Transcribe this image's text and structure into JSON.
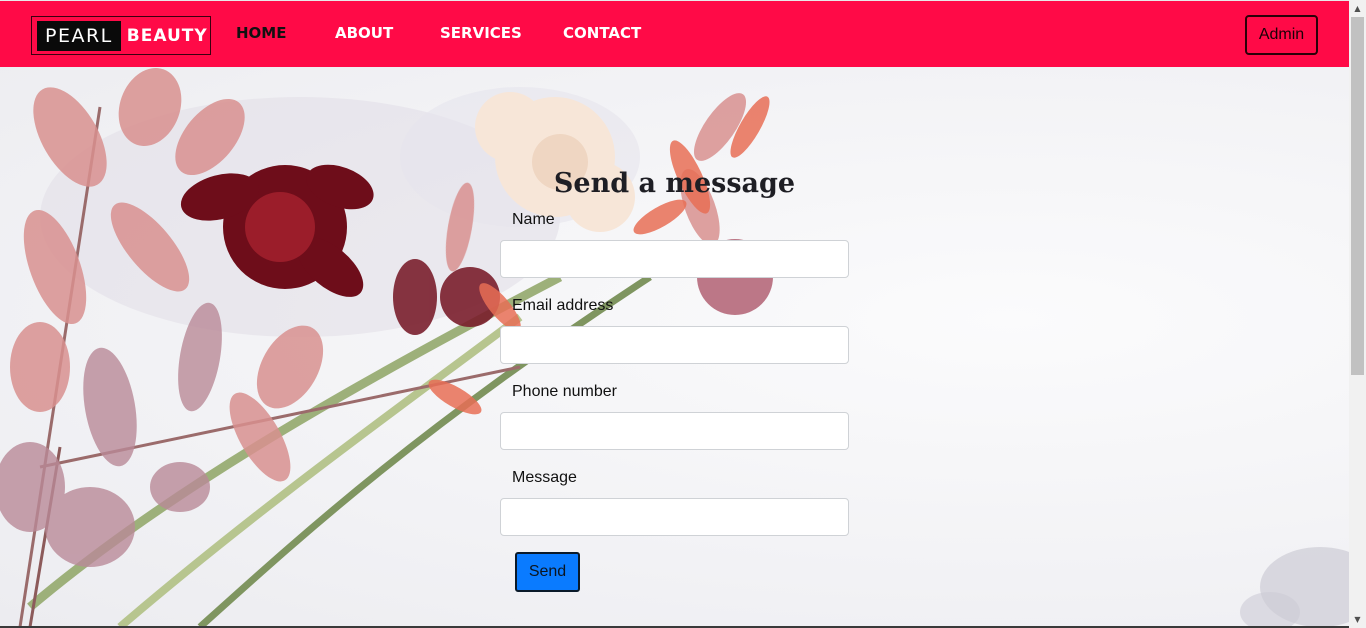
{
  "navbar": {
    "background": "#ff0a47",
    "logo": {
      "pearl": "PEARL",
      "beauty": "BEAUTY"
    },
    "links": [
      {
        "label": "HOME",
        "active": true
      },
      {
        "label": "ABOUT",
        "active": false
      },
      {
        "label": "SERVICES",
        "active": false
      },
      {
        "label": "CONTACT",
        "active": false
      }
    ],
    "admin_label": "Admin"
  },
  "form": {
    "title": "Send a message",
    "fields": [
      {
        "label": "Name",
        "value": ""
      },
      {
        "label": "Email address",
        "value": ""
      },
      {
        "label": "Phone number",
        "value": ""
      },
      {
        "label": "Message",
        "value": ""
      }
    ],
    "send_label": "Send",
    "send_color": "#0a7bff"
  },
  "icons": {
    "scroll_up": "▲",
    "scroll_down": "▼"
  }
}
